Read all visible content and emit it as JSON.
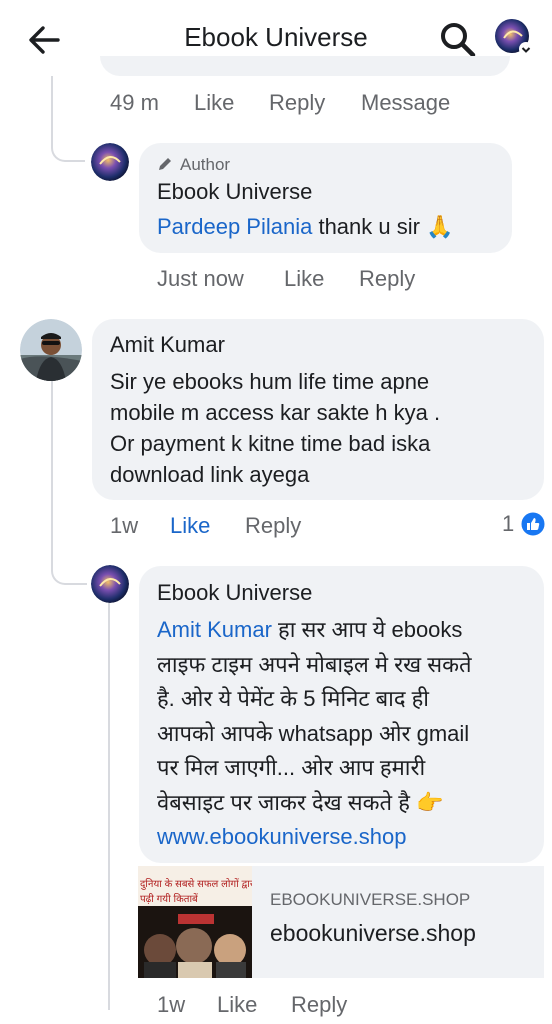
{
  "header": {
    "title": "Ebook Universe"
  },
  "comments": [
    {
      "meta": {
        "time": "49 m",
        "like": "Like",
        "reply": "Reply",
        "message": "Message"
      }
    },
    {
      "author_tag": "Author",
      "name": "Ebook Universe",
      "mention": "Pardeep Pilania",
      "text": " thank u sir 🙏",
      "meta": {
        "time": "Just now",
        "like": "Like",
        "reply": "Reply"
      }
    },
    {
      "name": "Amit Kumar",
      "lines": [
        "Sir ye ebooks hum life time apne",
        "mobile m access kar sakte h kya .",
        "Or payment k kitne time bad iska",
        "download link ayega"
      ],
      "meta": {
        "time": "1w",
        "like": "Like",
        "reply": "Reply"
      },
      "reaction_count": "1"
    },
    {
      "name": "Ebook Universe",
      "mention": "Amit Kumar",
      "lines": [
        " हा सर आप ये ebooks",
        "लाइफ टाइम अपने मोबाइल मे रख सकते",
        "है. ओर ये पेमेंट के 5 मिनिट बाद ही",
        "आपको आपके whatsapp ओर gmail",
        "पर मिल जाएगी... ओर आप हमारी",
        "वेबसाइट पर जाकर देख सकते है 👉"
      ],
      "link": "www.ebookuniverse.shop",
      "card": {
        "domain": "EBOOKUNIVERSE.SHOP",
        "title": "ebookuniverse.shop",
        "thumb_line1": "दुनिया के सबसे सफल लोगों द्वारा लि",
        "thumb_line2": "पढ़ी गयी किताबें"
      },
      "meta": {
        "time": "1w",
        "like": "Like",
        "reply": "Reply"
      }
    }
  ],
  "colors": {
    "mention": "#1a66c9",
    "bubble": "#f0f2f5",
    "meta": "#65676b",
    "like_reaction": "#1877f2"
  },
  "icons": [
    "back-arrow-icon",
    "search-icon",
    "avatar-icon",
    "pencil-icon",
    "like-reaction-icon"
  ]
}
